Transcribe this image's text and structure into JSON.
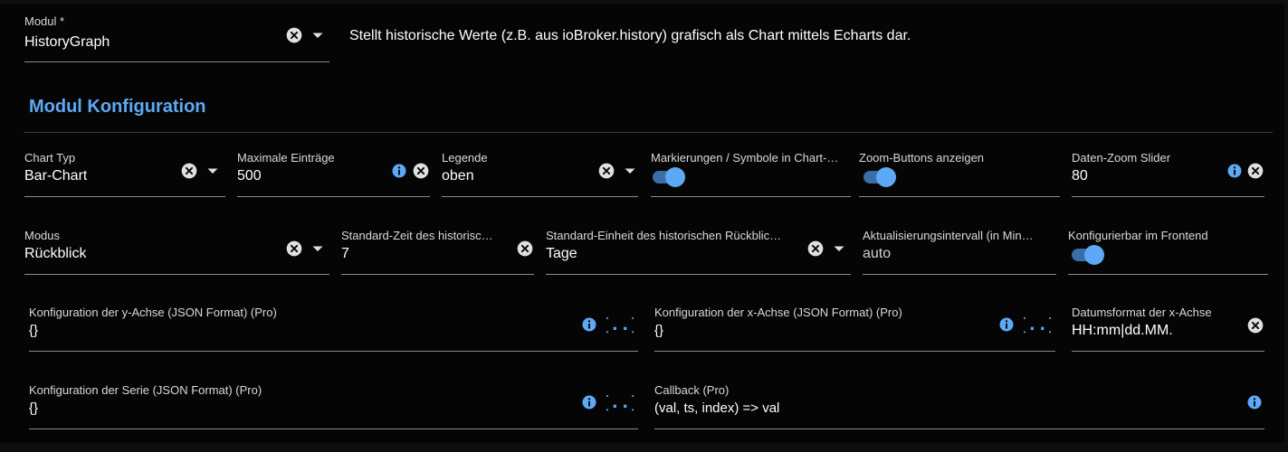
{
  "module": {
    "label": "Modul *",
    "value": "HistoryGraph",
    "description": "Stellt historische Werte (z.B. aus ioBroker.history) grafisch als Chart mittels Echarts dar."
  },
  "section_title": "Modul Konfiguration",
  "fields": {
    "chart_typ": {
      "label": "Chart Typ",
      "value": "Bar-Chart"
    },
    "max_entries": {
      "label": "Maximale Einträge",
      "value": "500"
    },
    "legend": {
      "label": "Legende",
      "value": "oben"
    },
    "markers": {
      "label": "Markierungen / Symbole in Chart-…",
      "enabled": true
    },
    "zoom_buttons": {
      "label": "Zoom-Buttons anzeigen",
      "enabled": true
    },
    "data_zoom": {
      "label": "Daten-Zoom Slider",
      "value": "80"
    },
    "mode": {
      "label": "Modus",
      "value": "Rückblick"
    },
    "default_time": {
      "label": "Standard-Zeit des historisc…",
      "value": "7"
    },
    "default_unit": {
      "label": "Standard-Einheit des historischen Rückblic…",
      "value": "Tage"
    },
    "refresh_interval": {
      "label": "Aktualisierungsintervall (in Min…",
      "value": "auto"
    },
    "frontend_config": {
      "label": "Konfigurierbar im Frontend",
      "enabled": true
    },
    "y_axis": {
      "label": "Konfiguration der y-Achse (JSON Format) (Pro)",
      "value": "{}"
    },
    "x_axis": {
      "label": "Konfiguration der x-Achse (JSON Format) (Pro)",
      "value": "{}"
    },
    "date_format": {
      "label": "Datumsformat der x-Achse",
      "value": "HH:mm|dd.MM."
    },
    "series": {
      "label": "Konfiguration der Serie (JSON Format) (Pro)",
      "value": "{}"
    },
    "callback": {
      "label": "Callback (Pro)",
      "value": "(val, ts, index) => val"
    }
  },
  "icons": {
    "clear": "clear-circle-icon",
    "dropdown": "caret-down-icon",
    "info": "info-circle-icon",
    "json_editor": "curly-braces-icon"
  },
  "colors": {
    "accent": "#5ea9f5",
    "background": "#050505",
    "toggle_track": "#3a6ea5",
    "clear_icon": "#e0e0e0"
  }
}
